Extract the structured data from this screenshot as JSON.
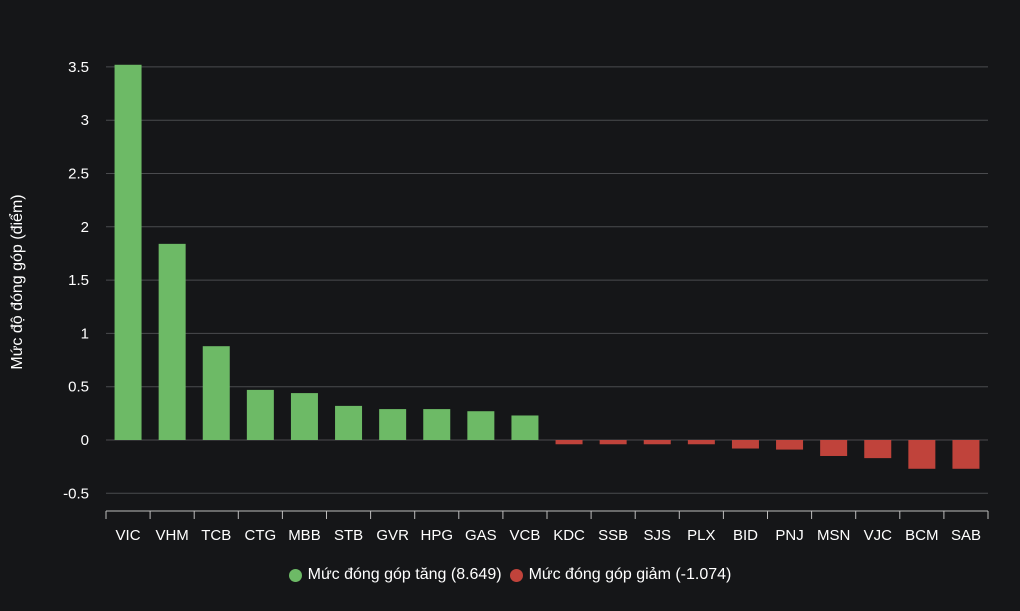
{
  "chart_data": {
    "type": "bar",
    "ylabel": "Mức độ đóng góp (điểm)",
    "ylim": [
      -0.6,
      3.8
    ],
    "yticks": [
      -0.5,
      0,
      0.5,
      1,
      1.5,
      2,
      2.5,
      3,
      3.5
    ],
    "grid": true,
    "legend_position": "bottom-center",
    "categories": [
      "VIC",
      "VHM",
      "TCB",
      "CTG",
      "MBB",
      "STB",
      "GVR",
      "HPG",
      "GAS",
      "VCB",
      "KDC",
      "SSB",
      "SJS",
      "PLX",
      "BID",
      "PNJ",
      "MSN",
      "VJC",
      "BCM",
      "SAB"
    ],
    "values": [
      3.52,
      1.84,
      0.88,
      0.47,
      0.44,
      0.32,
      0.29,
      0.29,
      0.27,
      0.23,
      -0.04,
      -0.04,
      -0.04,
      -0.04,
      -0.08,
      -0.09,
      -0.15,
      -0.17,
      -0.27,
      -0.27
    ],
    "series": [
      {
        "name": "Mức đóng góp tăng (8.649)",
        "color": "#6dba66"
      },
      {
        "name": "Mức đóng góp giảm (-1.074)",
        "color": "#c0433b"
      }
    ],
    "colors": {
      "positive": "#6dba66",
      "negative": "#c0433b",
      "grid": "#4a4b4e",
      "axis": "#bdbdbd"
    }
  }
}
